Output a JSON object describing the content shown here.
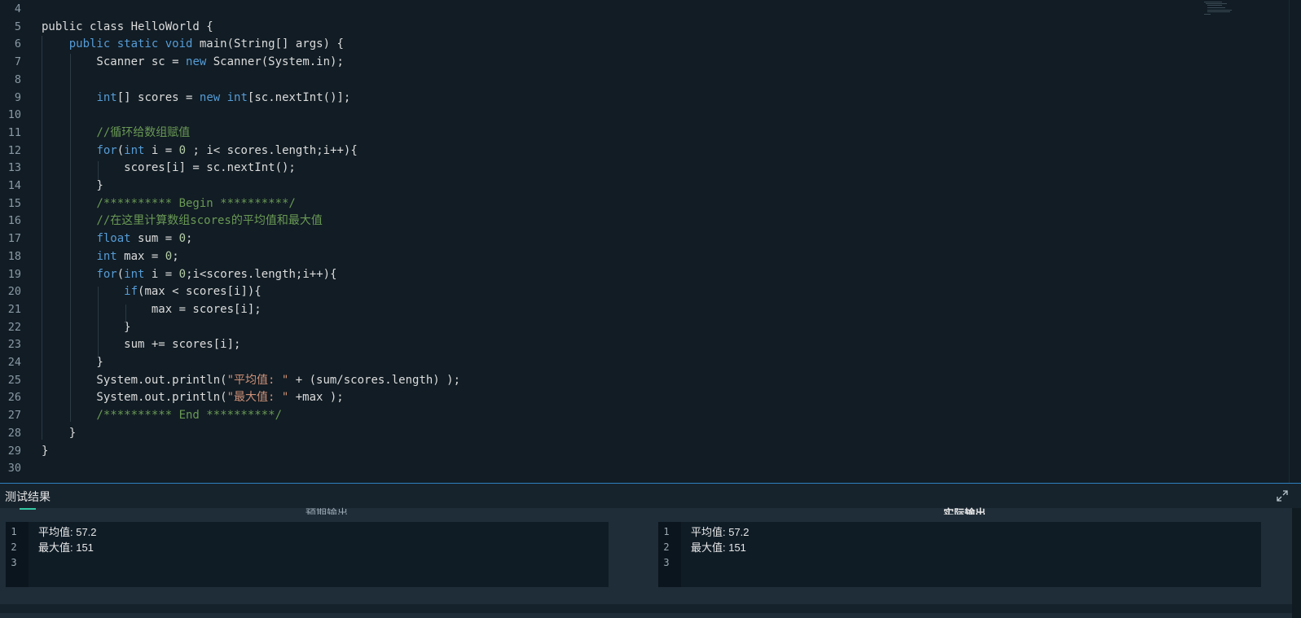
{
  "editor": {
    "lines": [
      {
        "n": "4",
        "parts": []
      },
      {
        "n": "5",
        "parts": [
          {
            "t": "public class HelloWorld {",
            "c": "tx"
          }
        ]
      },
      {
        "n": "6",
        "parts": [
          {
            "t": "    ",
            "c": "tx"
          },
          {
            "t": "public static void",
            "c": "kw"
          },
          {
            "t": " main(String[] args) {",
            "c": "tx"
          }
        ]
      },
      {
        "n": "7",
        "parts": [
          {
            "t": "        Scanner sc = ",
            "c": "tx"
          },
          {
            "t": "new",
            "c": "kw"
          },
          {
            "t": " Scanner(System.in);",
            "c": "tx"
          }
        ]
      },
      {
        "n": "8",
        "parts": []
      },
      {
        "n": "9",
        "parts": [
          {
            "t": "        ",
            "c": "tx"
          },
          {
            "t": "int",
            "c": "kw"
          },
          {
            "t": "[] scores = ",
            "c": "tx"
          },
          {
            "t": "new",
            "c": "kw"
          },
          {
            "t": " ",
            "c": "tx"
          },
          {
            "t": "int",
            "c": "kw"
          },
          {
            "t": "[sc.nextInt()];",
            "c": "tx"
          }
        ]
      },
      {
        "n": "10",
        "parts": []
      },
      {
        "n": "11",
        "parts": [
          {
            "t": "        //循环给数组赋值",
            "c": "cm"
          }
        ]
      },
      {
        "n": "12",
        "parts": [
          {
            "t": "        ",
            "c": "tx"
          },
          {
            "t": "for",
            "c": "kw"
          },
          {
            "t": "(",
            "c": "tx"
          },
          {
            "t": "int",
            "c": "kw"
          },
          {
            "t": " i = ",
            "c": "tx"
          },
          {
            "t": "0",
            "c": "num"
          },
          {
            "t": " ; i< scores.length;i++){",
            "c": "tx"
          }
        ]
      },
      {
        "n": "13",
        "parts": [
          {
            "t": "            scores[i] = sc.nextInt();",
            "c": "tx"
          }
        ]
      },
      {
        "n": "14",
        "parts": [
          {
            "t": "        }",
            "c": "tx"
          }
        ]
      },
      {
        "n": "15",
        "parts": [
          {
            "t": "        /********** Begin **********/",
            "c": "cm"
          }
        ]
      },
      {
        "n": "16",
        "parts": [
          {
            "t": "        //在这里计算数组scores的平均值和最大值",
            "c": "cm"
          }
        ]
      },
      {
        "n": "17",
        "parts": [
          {
            "t": "        ",
            "c": "tx"
          },
          {
            "t": "float",
            "c": "kw"
          },
          {
            "t": " sum = ",
            "c": "tx"
          },
          {
            "t": "0",
            "c": "num"
          },
          {
            "t": ";",
            "c": "tx"
          }
        ]
      },
      {
        "n": "18",
        "parts": [
          {
            "t": "        ",
            "c": "tx"
          },
          {
            "t": "int",
            "c": "kw"
          },
          {
            "t": " max = ",
            "c": "tx"
          },
          {
            "t": "0",
            "c": "num"
          },
          {
            "t": ";",
            "c": "tx"
          }
        ]
      },
      {
        "n": "19",
        "parts": [
          {
            "t": "        ",
            "c": "tx"
          },
          {
            "t": "for",
            "c": "kw"
          },
          {
            "t": "(",
            "c": "tx"
          },
          {
            "t": "int",
            "c": "kw"
          },
          {
            "t": " i = ",
            "c": "tx"
          },
          {
            "t": "0",
            "c": "num"
          },
          {
            "t": ";i<scores.length;i++){",
            "c": "tx"
          }
        ]
      },
      {
        "n": "20",
        "parts": [
          {
            "t": "            ",
            "c": "tx"
          },
          {
            "t": "if",
            "c": "kw"
          },
          {
            "t": "(max < scores[i]){",
            "c": "tx"
          }
        ]
      },
      {
        "n": "21",
        "parts": [
          {
            "t": "                max = scores[i];",
            "c": "tx"
          }
        ]
      },
      {
        "n": "22",
        "parts": [
          {
            "t": "            }",
            "c": "tx"
          }
        ]
      },
      {
        "n": "23",
        "parts": [
          {
            "t": "            sum += scores[i];",
            "c": "tx"
          }
        ]
      },
      {
        "n": "24",
        "parts": [
          {
            "t": "        }",
            "c": "tx"
          }
        ]
      },
      {
        "n": "25",
        "parts": [
          {
            "t": "        System.out.println(",
            "c": "tx"
          },
          {
            "t": "\"平均值: \"",
            "c": "str"
          },
          {
            "t": " + (sum/scores.length) );",
            "c": "tx"
          }
        ]
      },
      {
        "n": "26",
        "parts": [
          {
            "t": "        System.out.println(",
            "c": "tx"
          },
          {
            "t": "\"最大值: \"",
            "c": "str"
          },
          {
            "t": " +max );",
            "c": "tx"
          }
        ]
      },
      {
        "n": "27",
        "parts": [
          {
            "t": "        /********** End **********/",
            "c": "cm"
          }
        ]
      },
      {
        "n": "28",
        "parts": [
          {
            "t": "    }",
            "c": "tx"
          }
        ]
      },
      {
        "n": "29",
        "parts": [
          {
            "t": "}",
            "c": "tx"
          }
        ]
      },
      {
        "n": "30",
        "parts": []
      }
    ]
  },
  "panel": {
    "title": "测试结果",
    "expected_label": "预期输出",
    "actual_label": "实际输出",
    "expected_output": [
      {
        "n": "1",
        "t": "平均值: 57.2"
      },
      {
        "n": "2",
        "t": "最大值: 151"
      },
      {
        "n": "3",
        "t": ""
      }
    ],
    "actual_output": [
      {
        "n": "1",
        "t": "平均值: 57.2"
      },
      {
        "n": "2",
        "t": "最大值: 151"
      },
      {
        "n": "3",
        "t": ""
      }
    ]
  },
  "colors": {
    "keyword": "#569cd6",
    "comment": "#6a9955",
    "string": "#ce9178",
    "accent": "#2d7fc1",
    "tab_indicator": "#35c9a3"
  },
  "icons": {
    "expand": "expand-arrows-icon"
  }
}
